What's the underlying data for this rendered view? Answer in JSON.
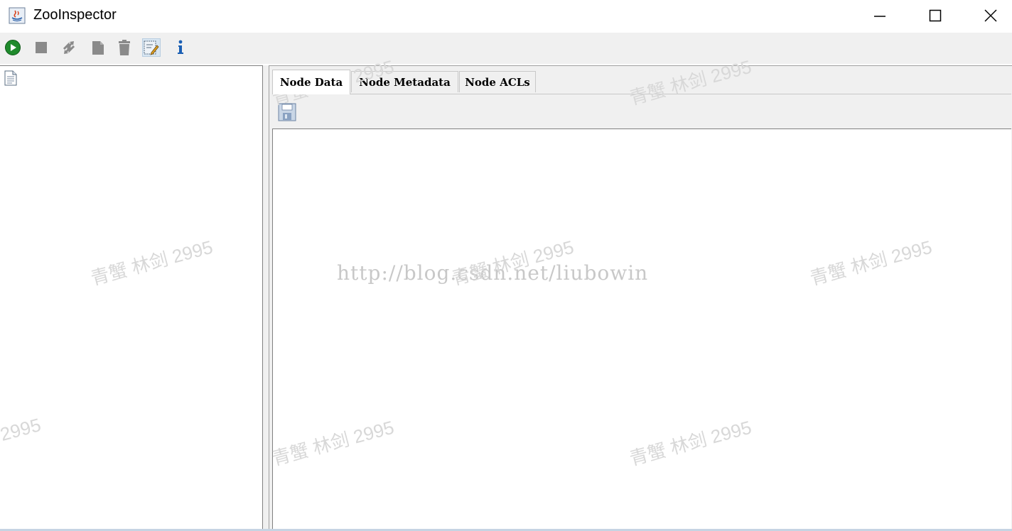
{
  "window": {
    "title": "ZooInspector",
    "controls": {
      "minimize_icon": "minimize-icon",
      "maximize_icon": "maximize-icon",
      "close_icon": "close-icon"
    }
  },
  "toolbar": {
    "buttons": [
      {
        "name": "connect-button",
        "icon": "play-icon",
        "enabled": true
      },
      {
        "name": "disconnect-button",
        "icon": "stop-icon",
        "enabled": false
      },
      {
        "name": "refresh-button",
        "icon": "refresh-icon",
        "enabled": false
      },
      {
        "name": "add-node-button",
        "icon": "add-node-icon",
        "enabled": false
      },
      {
        "name": "delete-node-button",
        "icon": "trash-icon",
        "enabled": false
      },
      {
        "name": "node-viewers-button",
        "icon": "edit-icon",
        "enabled": true,
        "selected": true
      },
      {
        "name": "about-button",
        "icon": "info-icon",
        "enabled": true
      }
    ]
  },
  "tree": {
    "root_icon": "document-icon"
  },
  "tabs": [
    {
      "label": "Node Data",
      "active": true
    },
    {
      "label": "Node Metadata",
      "active": false
    },
    {
      "label": "Node ACLs",
      "active": false
    }
  ],
  "node_data": {
    "save_icon": "save-icon",
    "content": ""
  },
  "watermark": {
    "url": "http://blog.csdn.net/liubowin",
    "tag": "青蟹 林剑 2995",
    "tag_partial": "2995"
  },
  "colors": {
    "accent": "#2a8a2a",
    "info": "#1a5fb4",
    "disabled": "#888888"
  }
}
